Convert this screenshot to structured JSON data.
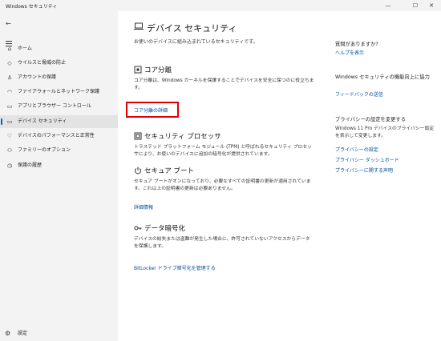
{
  "window": {
    "title": "Windows セキュリティ",
    "minimize_glyph": "—",
    "maximize_glyph": "☐",
    "close_glyph": "✕"
  },
  "sidebar": {
    "back_glyph": "←",
    "items": [
      {
        "label": "ホーム",
        "icon": "home-icon",
        "glyph": "⌂"
      },
      {
        "label": "ウイルスと脅威の防止",
        "icon": "shield-icon",
        "glyph": "◇"
      },
      {
        "label": "アカウントの保護",
        "icon": "person-icon",
        "glyph": "♙"
      },
      {
        "label": "ファイアウォールとネットワーク保護",
        "icon": "wifi-icon",
        "glyph": "◠"
      },
      {
        "label": "アプリとブラウザー コントロール",
        "icon": "app-window-icon",
        "glyph": "▭"
      },
      {
        "label": "デバイス セキュリティ",
        "icon": "laptop-icon",
        "glyph": "▭"
      },
      {
        "label": "デバイスのパフォーマンスと正常性",
        "icon": "heart-icon",
        "glyph": "♡"
      },
      {
        "label": "ファミリーのオプション",
        "icon": "family-icon",
        "glyph": "⚇"
      },
      {
        "label": "保護の履歴",
        "icon": "history-icon",
        "glyph": "◷"
      }
    ],
    "settings": {
      "label": "設定",
      "icon": "gear-icon",
      "glyph": "⚙"
    }
  },
  "main": {
    "title": "デバイス セキュリティ",
    "subtitle": "お使いのデバイスに組み込まれているセキュリティです。",
    "sections": [
      {
        "title": "コア分離",
        "desc": "コア分離は、Windows カーネルを保護することでデバイスを安全に保つのに役立ちます。",
        "link": "コア分離の詳細"
      },
      {
        "title": "セキュリティ プロセッサ",
        "desc": "トラステッド プラットフォーム モジュール (TPM) と呼ばれるセキュリティ プロセッサにより、お使いのデバイスに追加の暗号化が提供されています。",
        "link": ""
      },
      {
        "title": "セキュア ブート",
        "desc": "セキュア ブートがオンになっており、必要なすべての証明書の更新が適用されています。これ以上の証明書の更新は必要ありません。",
        "link": "詳細情報"
      },
      {
        "title": "データ暗号化",
        "desc": "デバイスの紛失または盗難が発生した場合に、許可されていないアクセスからデータを保護します。",
        "link": "BitLocker ドライブ暗号化を管理する"
      }
    ]
  },
  "right_panel": {
    "questions_head": "質問がありますか?",
    "help_link": "ヘルプを表示",
    "improve_head": "Windows セキュリティの機能向上に協力",
    "feedback_link": "フィードバックの送信",
    "privacy_head": "プライバシーの設定を変更する",
    "privacy_text": "Windows 11 Pro デバイスのプライバシー設定を表示して変更します。",
    "privacy_links": [
      "プライバシーの設定",
      "プライバシー ダッシュボード",
      "プライバシーに関する声明"
    ]
  }
}
